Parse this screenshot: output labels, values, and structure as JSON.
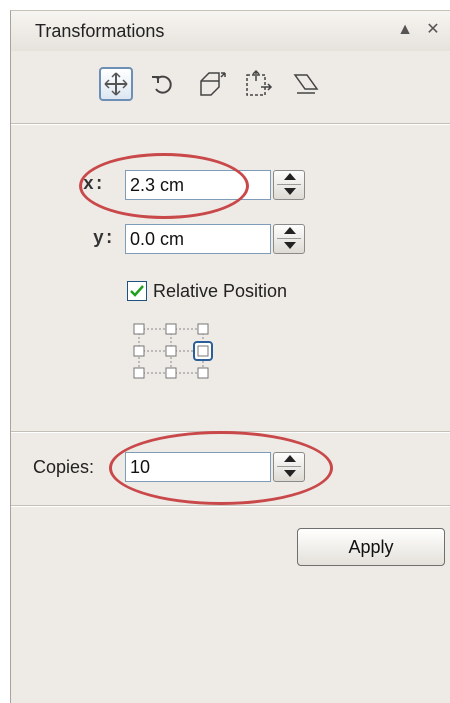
{
  "panel": {
    "title": "Transformations",
    "title_buttons": {
      "collapse": "▲",
      "close": "✕"
    }
  },
  "toolbar": {
    "tools": [
      {
        "name": "position",
        "icon": "position-crosshair-icon",
        "active": true
      },
      {
        "name": "rotate",
        "icon": "rotate-icon",
        "active": false
      },
      {
        "name": "scale-mirror",
        "icon": "scale-mirror-icon",
        "active": false
      },
      {
        "name": "size",
        "icon": "size-icon",
        "active": false
      },
      {
        "name": "skew",
        "icon": "skew-icon",
        "active": false
      }
    ]
  },
  "position": {
    "x_label": "x:",
    "x_value": "2.3 cm",
    "y_label": "y:",
    "y_value": "0.0 cm",
    "relative_label": "Relative Position",
    "relative_checked": true,
    "anchor_selected": "middle-right"
  },
  "copies": {
    "label": "Copies:",
    "value": "10"
  },
  "apply_label": "Apply",
  "colors": {
    "panel_bg": "#eeeae5",
    "highlight_ellipse": "#c9484a",
    "active_tool_border": "#6d8fb5",
    "checkmark": "#20a020"
  }
}
